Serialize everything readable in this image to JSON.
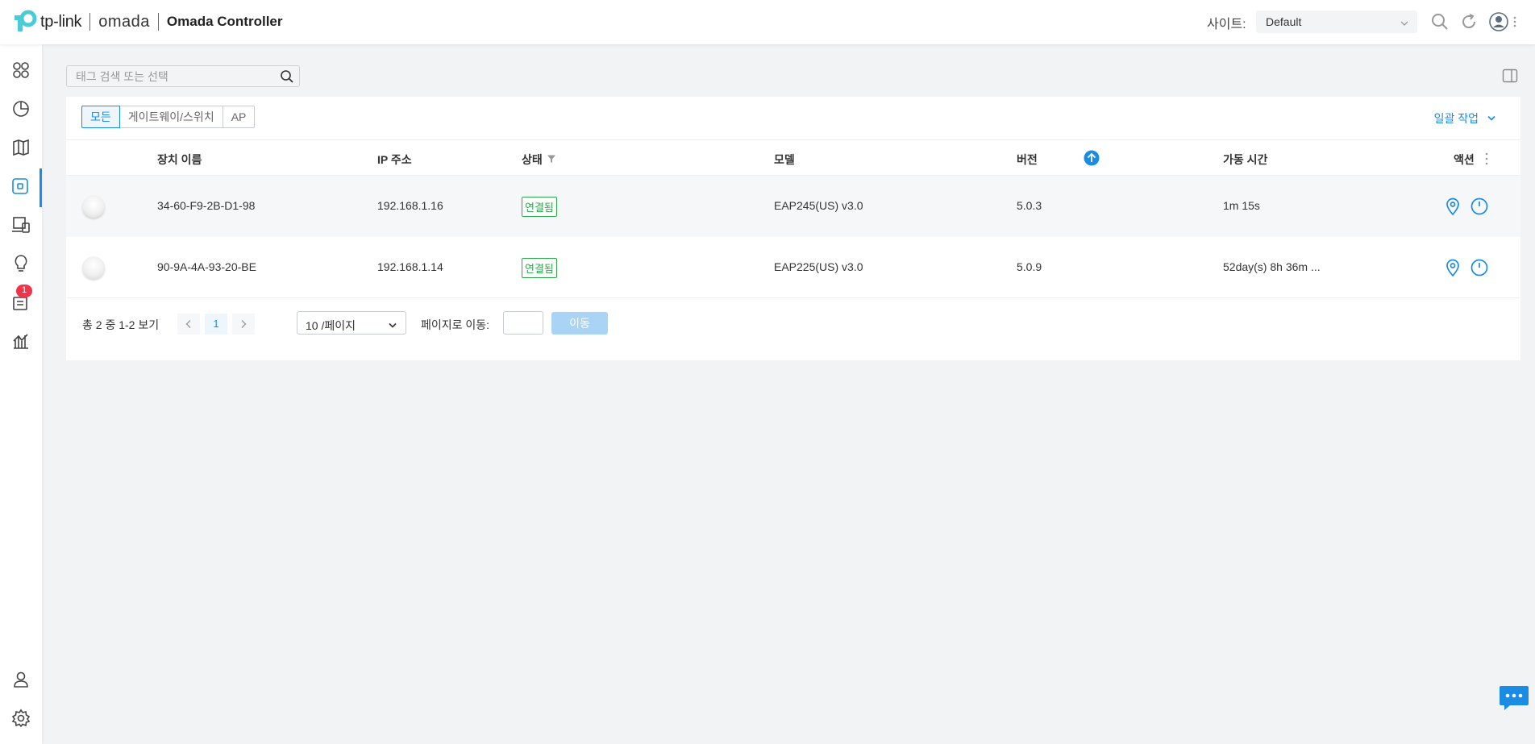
{
  "header": {
    "brand": "tp-link",
    "product": "omada",
    "app_title": "Omada Controller",
    "site_label": "사이트:",
    "site_value": "Default"
  },
  "sidebar": {
    "alerts_badge": "1"
  },
  "search": {
    "placeholder": "태그 검색 또는 선택"
  },
  "tabs": [
    "모든",
    "게이트웨이/스위치",
    "AP"
  ],
  "bulk_action": "일괄 작업",
  "table": {
    "columns": {
      "name": "장치 이름",
      "ip": "IP 주소",
      "status": "상태",
      "model": "모델",
      "version": "버전",
      "uptime": "가동 시간",
      "actions": "액션"
    },
    "rows": [
      {
        "name": "34-60-F9-2B-D1-98",
        "ip": "192.168.1.16",
        "status": "연결됨",
        "model": "EAP245(US) v3.0",
        "version": "5.0.3",
        "uptime": "1m 15s"
      },
      {
        "name": "90-9A-4A-93-20-BE",
        "ip": "192.168.1.14",
        "status": "연결됨",
        "model": "EAP225(US) v3.0",
        "version": "5.0.9",
        "uptime": "52day(s) 8h 36m ..."
      }
    ]
  },
  "pagination": {
    "total_text": "총 2 중 1-2 보기",
    "current_page": "1",
    "page_size": "10 /페이지",
    "goto_label": "페이지로 이동:",
    "go_button": "이동"
  },
  "colors": {
    "accent": "#1b8ce3",
    "connected": "#2ba84a",
    "badge": "#f0354a"
  }
}
